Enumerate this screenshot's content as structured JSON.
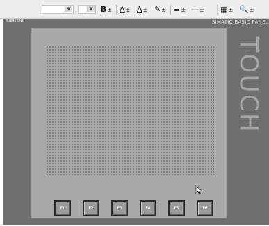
{
  "toolbar": {
    "combos": [
      {
        "name": "font-name-select",
        "value": ""
      },
      {
        "name": "font-size-select",
        "value": ""
      }
    ],
    "buttons": [
      {
        "name": "bold-button",
        "label": "B",
        "dropdown": "±"
      },
      {
        "name": "text-color-button",
        "label": "A",
        "dropdown": "±"
      },
      {
        "name": "fill-color-button",
        "label": "A",
        "dropdown": "±"
      },
      {
        "name": "line-color-button",
        "label": "✎",
        "dropdown": "±"
      },
      {
        "name": "align-button",
        "label": "≡",
        "dropdown": "±"
      },
      {
        "name": "line-style-button",
        "label": "—",
        "dropdown": "±"
      },
      {
        "name": "pattern-button",
        "label": "▦",
        "dropdown": "±"
      },
      {
        "name": "zoom-button",
        "label": "🔍",
        "dropdown": "±"
      }
    ]
  },
  "panel": {
    "brand": "SIEMENS",
    "model": "SIMATIC BASIC PANEL",
    "touch_label": "TOUCH",
    "function_keys": [
      "F1",
      "F2",
      "F3",
      "F4",
      "F5",
      "F6"
    ]
  }
}
